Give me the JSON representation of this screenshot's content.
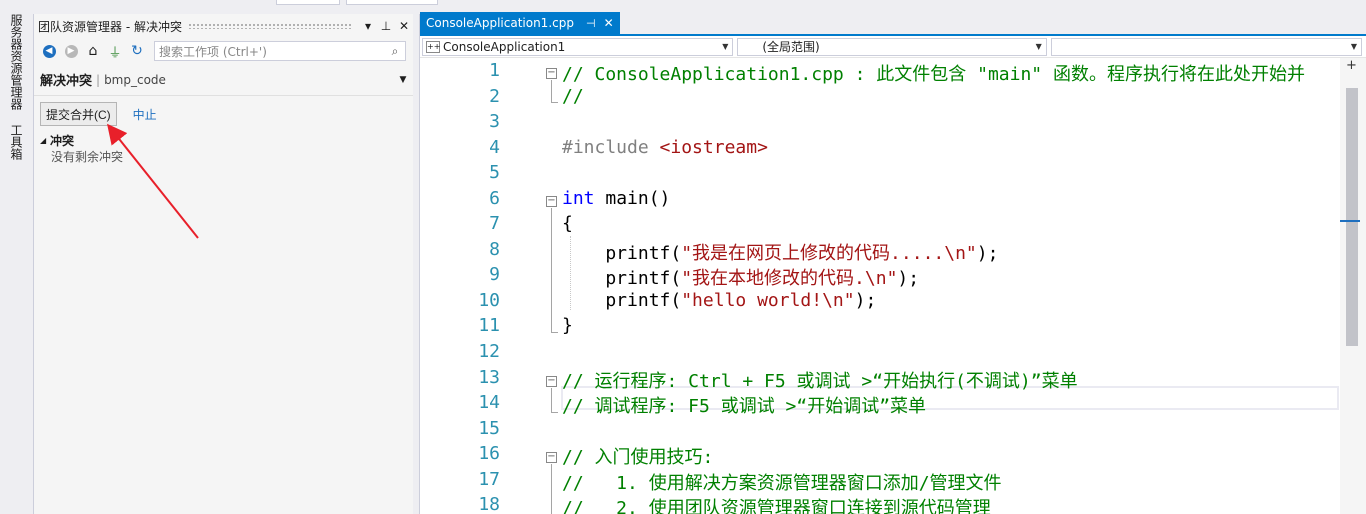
{
  "side_strip": {
    "tabs": [
      "服务器资源管理器",
      "工具箱"
    ]
  },
  "team_explorer": {
    "title": "团队资源管理器 - 解决冲突",
    "pin_icon": "pin-icon",
    "close_icon": "close-icon",
    "search_placeholder": "搜索工作项 (Ctrl+')",
    "page_title": "解决冲突",
    "repo_name": "bmp_code",
    "commit_merge_label": "提交合并(C)",
    "abort_label": "中止",
    "conflicts_header": "冲突",
    "conflicts_empty": "没有剩余冲突"
  },
  "editor": {
    "tab_label": "ConsoleApplication1.cpp",
    "nav": {
      "project": "ConsoleApplication1",
      "scope": "(全局范围)",
      "member": ""
    },
    "lines": [
      {
        "n": "1",
        "text": "// ConsoleApplication1.cpp : 此文件包含 \"main\" 函数。程序执行将在此处开始并"
      },
      {
        "n": "2",
        "text": "//"
      },
      {
        "n": "3",
        "text": ""
      },
      {
        "n": "4",
        "text_pp": "#include ",
        "text_inc": "<iostream>"
      },
      {
        "n": "5",
        "text": ""
      },
      {
        "n": "6",
        "text_kw": "int",
        "text_rest": " main()"
      },
      {
        "n": "7",
        "text": "{"
      },
      {
        "n": "8",
        "pre": "    printf(",
        "str": "\"我是在网页上修改的代码.....\\n\"",
        "post": ");"
      },
      {
        "n": "9",
        "pre": "    printf(",
        "str": "\"我在本地修改的代码.\\n\"",
        "post": ");"
      },
      {
        "n": "10",
        "pre": "    printf(",
        "str": "\"hello world!\\n\"",
        "post": ");"
      },
      {
        "n": "11",
        "text": "}"
      },
      {
        "n": "12",
        "text": ""
      },
      {
        "n": "13",
        "text": "// 运行程序: Ctrl + F5 或调试 >“开始执行(不调试)”菜单"
      },
      {
        "n": "14",
        "text": "// 调试程序: F5 或调试 >“开始调试”菜单"
      },
      {
        "n": "15",
        "text": ""
      },
      {
        "n": "16",
        "text": "// 入门使用技巧:"
      },
      {
        "n": "17",
        "text": "//   1. 使用解决方案资源管理器窗口添加/管理文件"
      },
      {
        "n": "18",
        "text": "//   2. 使用团队资源管理器窗口连接到源代码管理"
      }
    ]
  },
  "colors": {
    "accent": "#007acc",
    "comment": "#008000",
    "keyword": "#0000ff",
    "string": "#a31515",
    "line_number": "#2b91af",
    "annotation_arrow": "#e8202a"
  }
}
